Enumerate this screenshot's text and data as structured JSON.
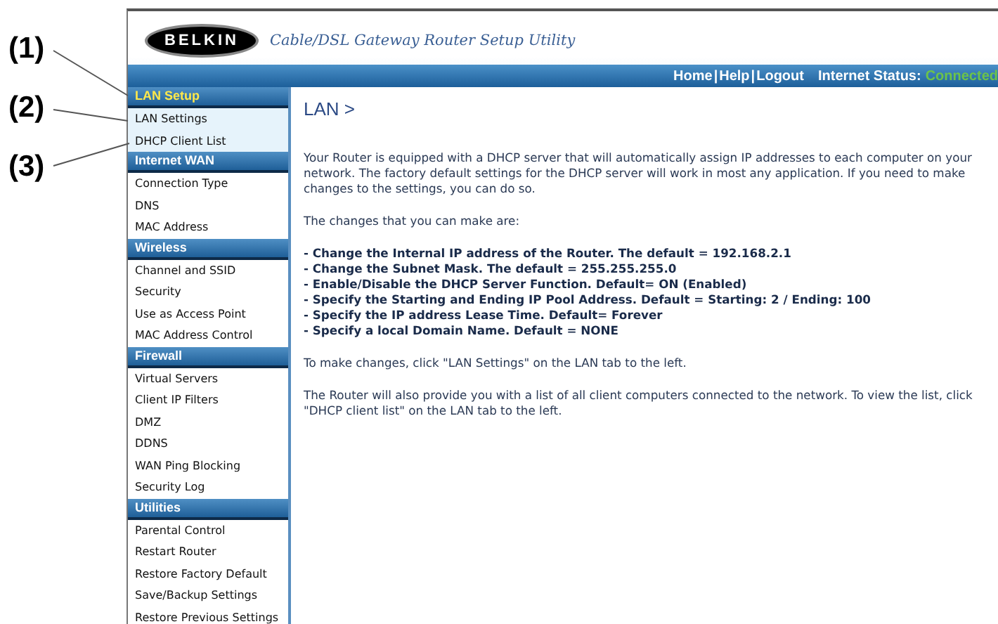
{
  "callouts": [
    "(1)",
    "(2)",
    "(3)"
  ],
  "header": {
    "logo": "BELKIN",
    "title": "Cable/DSL Gateway Router Setup Utility",
    "links": [
      "Home",
      "Help",
      "Logout"
    ],
    "separator": "|",
    "status_label": "Internet Status:",
    "status_value": "Connected"
  },
  "sidebar": [
    {
      "heading": "LAN Setup",
      "active": true,
      "items": [
        "LAN Settings",
        "DHCP Client List"
      ]
    },
    {
      "heading": "Internet WAN",
      "active": false,
      "items": [
        "Connection Type",
        "DNS",
        "MAC Address"
      ]
    },
    {
      "heading": "Wireless",
      "active": false,
      "items": [
        "Channel and SSID",
        "Security",
        "Use as Access Point",
        "MAC Address Control"
      ]
    },
    {
      "heading": "Firewall",
      "active": false,
      "items": [
        "Virtual Servers",
        "Client IP Filters",
        "DMZ",
        "DDNS",
        "WAN Ping Blocking",
        "Security Log"
      ]
    },
    {
      "heading": "Utilities",
      "active": false,
      "items": [
        "Parental Control",
        "Restart Router",
        "Restore Factory Default",
        "Save/Backup Settings",
        "Restore Previous Settings"
      ]
    }
  ],
  "content": {
    "heading": "LAN >",
    "intro": "Your Router is equipped with a DHCP server that will automatically assign IP addresses to each computer on your network. The factory default settings for the DHCP server will work in most any application. If you need to make changes to the settings, you can do so.",
    "list_title": "The changes that you can make are:",
    "changes": [
      "- Change the Internal IP address of the Router. The default = 192.168.2.1",
      "- Change the Subnet Mask. The default = 255.255.255.0",
      "- Enable/Disable the DHCP Server Function. Default= ON (Enabled)",
      "- Specify the Starting and Ending IP Pool Address. Default = Starting: 2 / Ending: 100",
      "- Specify the IP address Lease Time. Default= Forever",
      "- Specify a local Domain Name. Default = NONE"
    ],
    "paragraphs": [
      "To make changes, click \"LAN Settings\" on the LAN tab to the left.",
      "The Router will also provide you with a list of all client computers connected to the network. To view the list, click \"DHCP client list\" on the LAN tab to the left."
    ]
  }
}
